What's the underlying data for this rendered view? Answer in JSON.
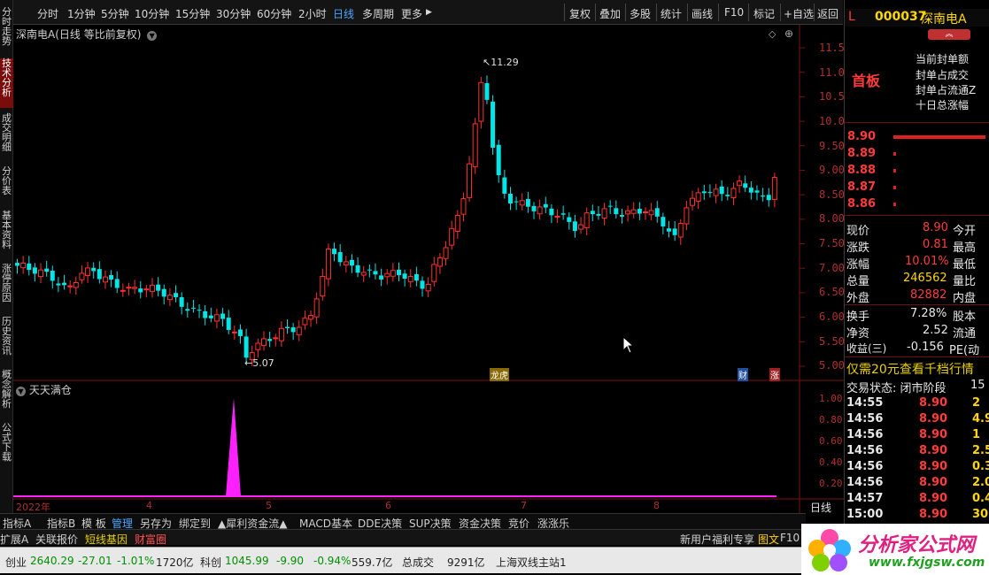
{
  "toolbar": {
    "periods": [
      "分时",
      "1分钟",
      "5分钟",
      "10分钟",
      "15分钟",
      "30分钟",
      "60分钟",
      "2小时",
      "日线",
      "多周期",
      "更多"
    ],
    "more_arrow": "▶",
    "right_buttons": [
      "复权",
      "叠加",
      "多股",
      "统计",
      "画线",
      "F10",
      "标记",
      "+自选",
      "返回"
    ]
  },
  "left_tabs": [
    "分时走势",
    "技术分析",
    "成交明细",
    "分价表",
    "基本资料",
    "涨停原因",
    "历史资讯",
    "概念解析",
    "公式下载"
  ],
  "chart": {
    "title": "深南电A(日线 等比前复权)",
    "y_axis": [
      "11.50",
      "11.00",
      "10.50",
      "10.00",
      "9.50",
      "9.00",
      "8.50",
      "8.00",
      "7.50",
      "7.00",
      "6.50",
      "6.00",
      "5.50",
      "5.00"
    ],
    "high_label": "11.29",
    "low_label": "5.07",
    "markers": [
      "龙虎",
      "财",
      "涨"
    ],
    "indicator_title": "天天满仓",
    "indicator_axis": [
      "1.00",
      "0.80",
      "0.60",
      "0.40",
      "0.20"
    ],
    "x_labels": [
      "2022年",
      "4",
      "5",
      "6",
      "7",
      "8"
    ],
    "period_label": "日线",
    "colors": {
      "up": "#ff3030",
      "down": "#00e5e5",
      "spike": "#ff20ff"
    }
  },
  "chart_data": {
    "type": "candlestick",
    "title": "深南电A(日线 等比前复权)",
    "ylim": [
      4.8,
      11.7
    ],
    "annotations": [
      {
        "label": "11.29",
        "value": 11.29
      },
      {
        "label": "5.07",
        "value": 5.07
      }
    ],
    "indicator": {
      "name": "天天满仓",
      "ylim": [
        0,
        1.0
      ],
      "spike_value": 1.0
    }
  },
  "bottom_tabs": [
    "指标A",
    "指标B",
    "模 板",
    "管理",
    "另存为",
    "绑定到",
    "▲犀利资金流▲",
    "MACD基本",
    "DDE决策",
    "SUP决策",
    "资金决策",
    "竞价",
    "涨涨乐"
  ],
  "ext_bar": {
    "items": [
      "扩展A",
      "关联报价",
      "短线基因",
      "财富圈"
    ],
    "right_text": "新用户福利专享",
    "right_items": [
      "图文",
      "F10"
    ]
  },
  "status_bar": {
    "cy_name": "创业",
    "cy_price": "2640.29",
    "cy_change": "-27.01",
    "cy_pct": "-1.01%",
    "cy_amount": "1720亿",
    "kc_name": "科创",
    "kc_price": "1045.99",
    "kc_change": "-9.90",
    "kc_pct": "-0.94%",
    "kc_amount": "559.7亿",
    "total_label": "总成交",
    "total_value": "9291亿",
    "server": "上海双线主站1"
  },
  "right_panel": {
    "flag": "L",
    "code": "000037",
    "name": "深南电A",
    "badge": "首板",
    "seal_rows": [
      "当前封单额",
      "封单占成交",
      "封单占流通Z",
      "十日总涨幅"
    ],
    "order_book": [
      {
        "price": "8.90"
      },
      {
        "price": "8.89"
      },
      {
        "price": "8.88"
      },
      {
        "price": "8.87"
      },
      {
        "price": "8.86"
      }
    ],
    "quotes": [
      {
        "label": "现价",
        "value": "8.90",
        "label2": "今开"
      },
      {
        "label": "涨跌",
        "value": "0.81",
        "label2": "最高"
      },
      {
        "label": "涨幅",
        "value": "10.01%",
        "label2": "最低"
      },
      {
        "label": "总量",
        "value": "246562",
        "label2": "量比"
      },
      {
        "label": "外盘",
        "value": "82882",
        "label2": "内盘"
      },
      {
        "label": "换手",
        "value": "7.28%",
        "label2": "股本"
      },
      {
        "label": "净资",
        "value": "2.52",
        "label2": "流通"
      },
      {
        "label": "收益(三)",
        "value": "-0.156",
        "label2": "PE(动"
      }
    ],
    "promo": "仅需20元查看千档行情",
    "trade_state": "交易状态: 闭市阶段",
    "trade_state_num": "15",
    "ticks": [
      {
        "time": "14:55",
        "price": "8.90",
        "vol": "2"
      },
      {
        "time": "14:56",
        "price": "8.90",
        "vol": "4.9"
      },
      {
        "time": "14:56",
        "price": "8.90",
        "vol": "1"
      },
      {
        "time": "14:56",
        "price": "8.90",
        "vol": "2.5"
      },
      {
        "time": "14:56",
        "price": "8.90",
        "vol": "0.3"
      },
      {
        "time": "14:56",
        "price": "8.90",
        "vol": "2.0"
      },
      {
        "time": "14:57",
        "price": "8.90",
        "vol": "0.4"
      },
      {
        "time": "15:00",
        "price": "8.90",
        "vol": "30.8"
      }
    ]
  },
  "logo": {
    "text": "分析家公式网",
    "url": "www.fxjgsw.com"
  }
}
